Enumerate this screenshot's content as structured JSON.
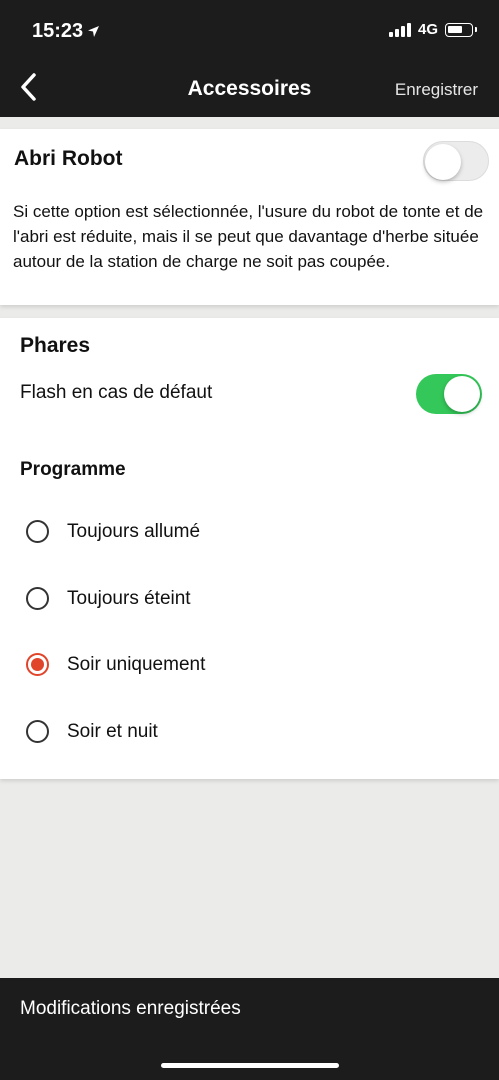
{
  "status_bar": {
    "time": "15:23",
    "network": "4G",
    "icons": [
      "location-arrow-icon",
      "signal-icon",
      "battery-icon"
    ]
  },
  "nav": {
    "back_icon": "chevron-left-icon",
    "title": "Accessoires",
    "save_label": "Enregistrer"
  },
  "robot_shelter": {
    "title": "Abri Robot",
    "enabled": false,
    "description": "Si cette option est sélectionnée, l'usure du robot de tonte et de l'abri est réduite, mais il se peut que davantage d'herbe située autour de la station de charge ne soit pas coupée."
  },
  "headlights": {
    "title": "Phares",
    "flash_label": "Flash en cas de défaut",
    "flash_enabled": true,
    "schedule_title": "Programme",
    "options": [
      {
        "label": "Toujours allumé",
        "selected": false
      },
      {
        "label": "Toujours éteint",
        "selected": false
      },
      {
        "label": "Soir uniquement",
        "selected": true
      },
      {
        "label": "Soir et nuit",
        "selected": false
      }
    ]
  },
  "toast": {
    "message": "Modifications enregistrées"
  },
  "colors": {
    "accent_green": "#34c759",
    "radio_selected": "#e0442a",
    "dark_bar": "#1c1c1c"
  }
}
